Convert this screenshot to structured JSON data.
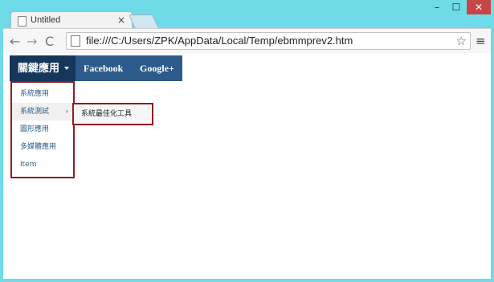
{
  "browser": {
    "tab_title": "Untitled",
    "tab_close": "×",
    "window_controls": {
      "minimize": "–",
      "maximize": "☐",
      "close": "✕"
    },
    "toolbar": {
      "back": "←",
      "forward": "→",
      "reload": "C",
      "url": "file:///C:/Users/ZPK/AppData/Local/Temp/ebmmprev2.htm",
      "bookmark_star": "☆",
      "menu": "≡"
    }
  },
  "page": {
    "navbar": {
      "items": [
        {
          "label": "關鍵應用"
        },
        {
          "label": "Facebook"
        },
        {
          "label": "Google+"
        }
      ]
    },
    "dropdown": {
      "items": [
        {
          "label": "系統應用"
        },
        {
          "label": "系統測試",
          "submenu_arrow": "›"
        },
        {
          "label": "圖形應用"
        },
        {
          "label": "多媒體應用"
        },
        {
          "label": "Item"
        }
      ],
      "submenu": {
        "items": [
          {
            "label": "系統最佳化工具"
          }
        ]
      }
    }
  },
  "colors": {
    "navbar": "#2c5b8b",
    "navbar_active": "#17365c",
    "highlight_border": "#8e1b25",
    "link": "#2d5c87",
    "chrome_bg": "#6fdbe8"
  }
}
